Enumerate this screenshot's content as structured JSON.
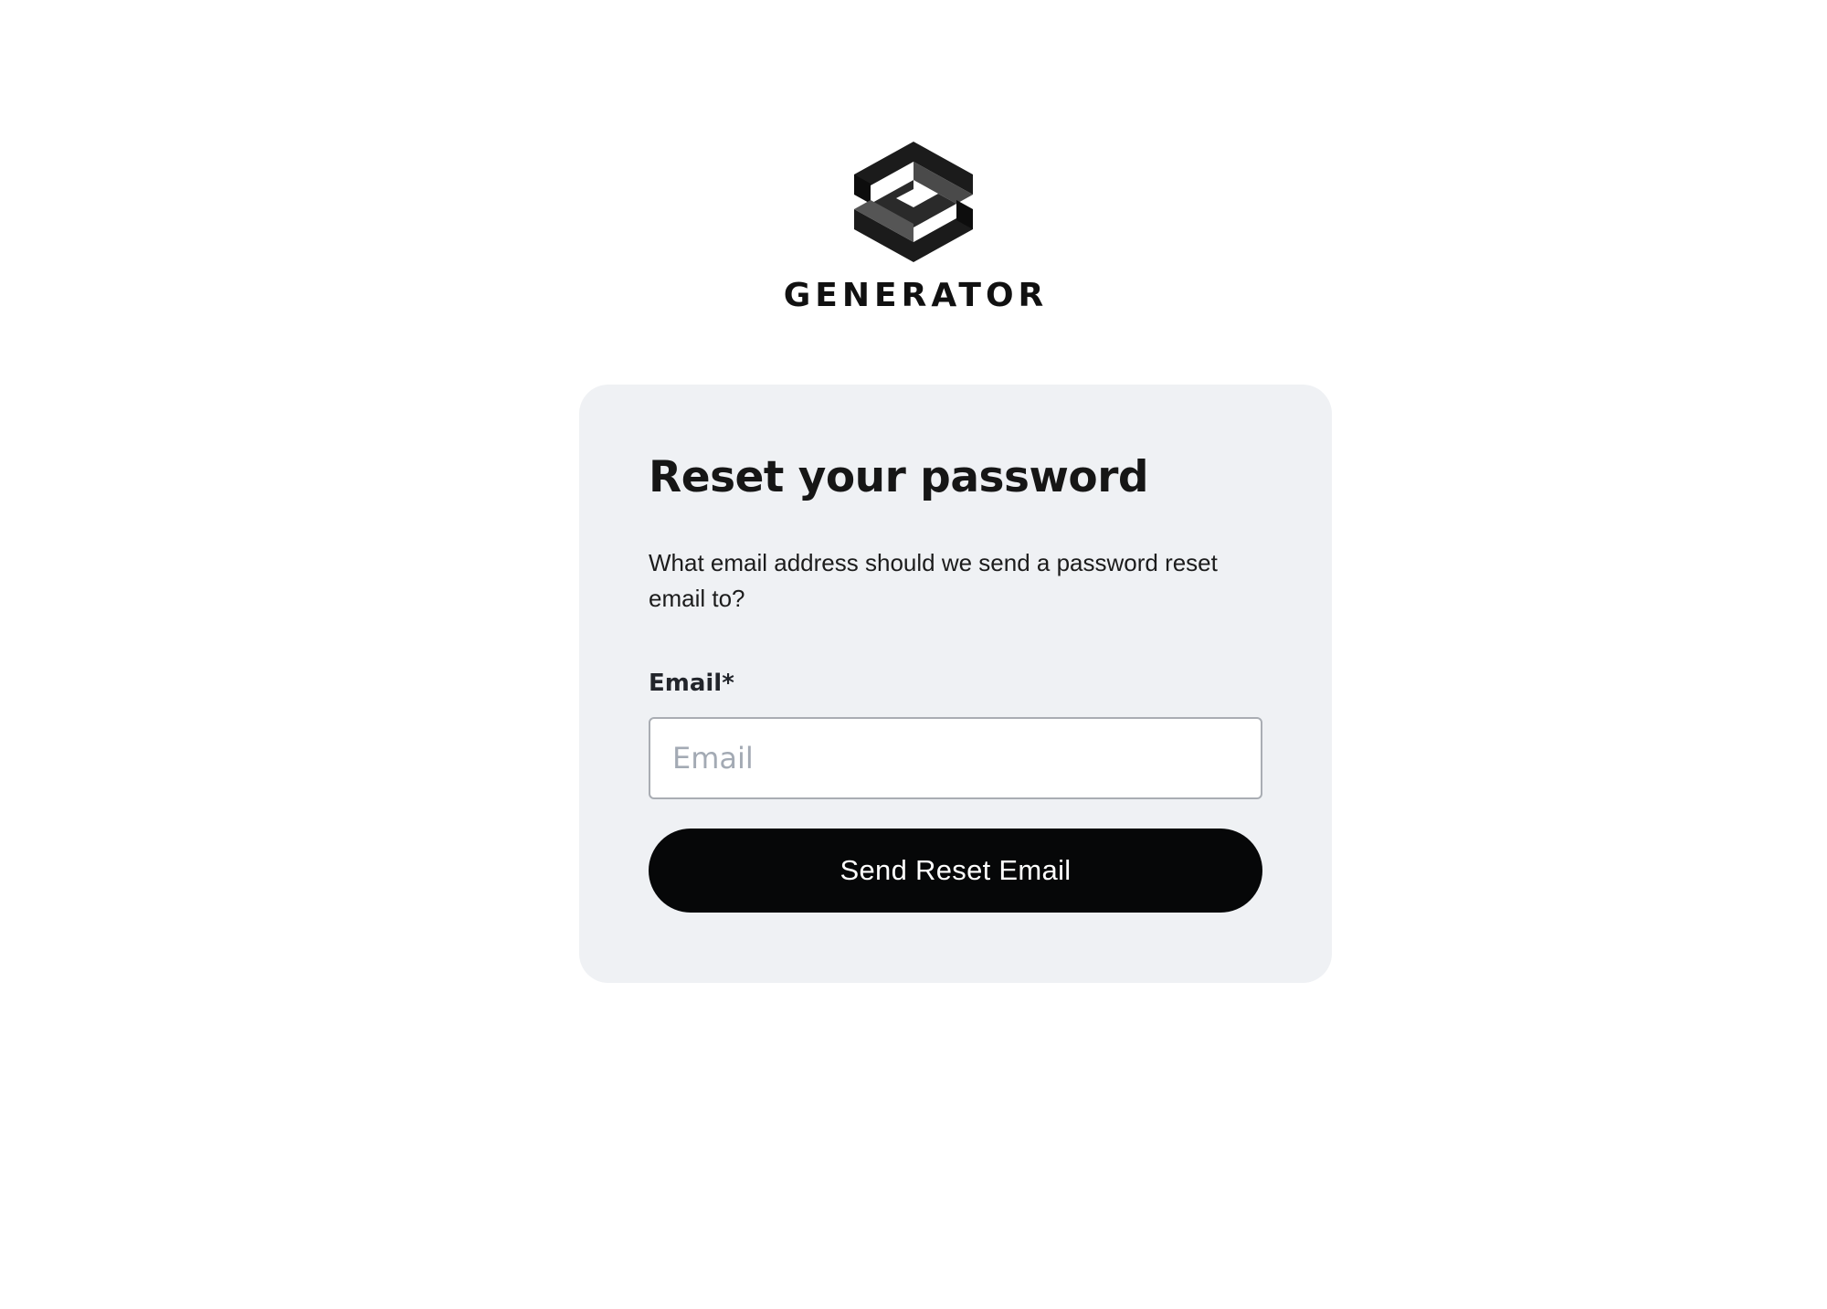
{
  "brand": {
    "logo_icon": "generator-logo-icon",
    "name": "GENERATOR"
  },
  "form": {
    "title": "Reset your password",
    "description": "What email address should we send a password reset email to?",
    "email_label": "Email*",
    "email_placeholder": "Email",
    "email_value": "",
    "submit_label": "Send Reset Email"
  },
  "colors": {
    "card_background": "#eff1f4",
    "button_background": "#060708",
    "button_text": "#ffffff",
    "placeholder_text": "#a3aab4"
  }
}
